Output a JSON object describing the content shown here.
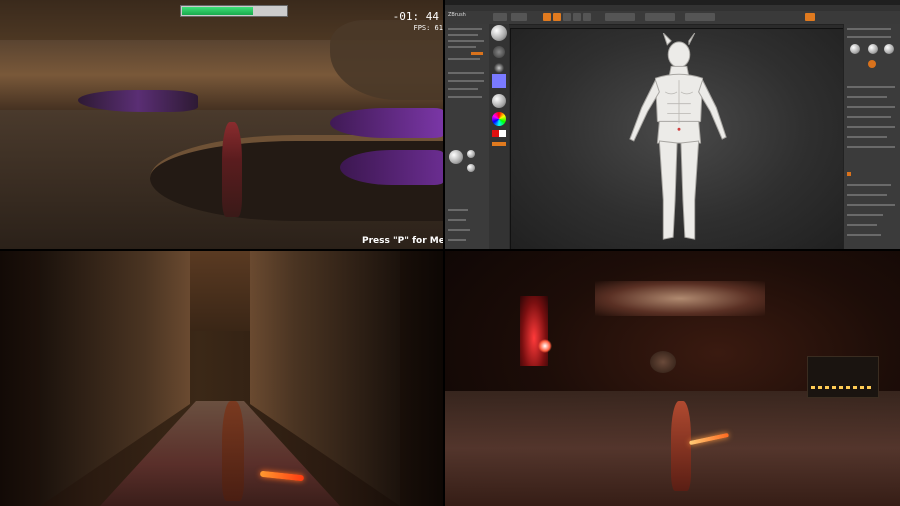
{
  "game_hud": {
    "health_fraction": 0.68,
    "timer": "-01: 44",
    "fps": "FPS: 61",
    "hint": "Press \"P\" for Menu and"
  },
  "editor": {
    "app_name": "ZBrush",
    "colors": {
      "accent": "#e07a1f",
      "canvas": "#2f2f2f",
      "panel": "#3b3b3b"
    }
  },
  "icons": [
    "health-bar",
    "sphere-brush-icon",
    "material-icon",
    "color-picker-icon"
  ]
}
